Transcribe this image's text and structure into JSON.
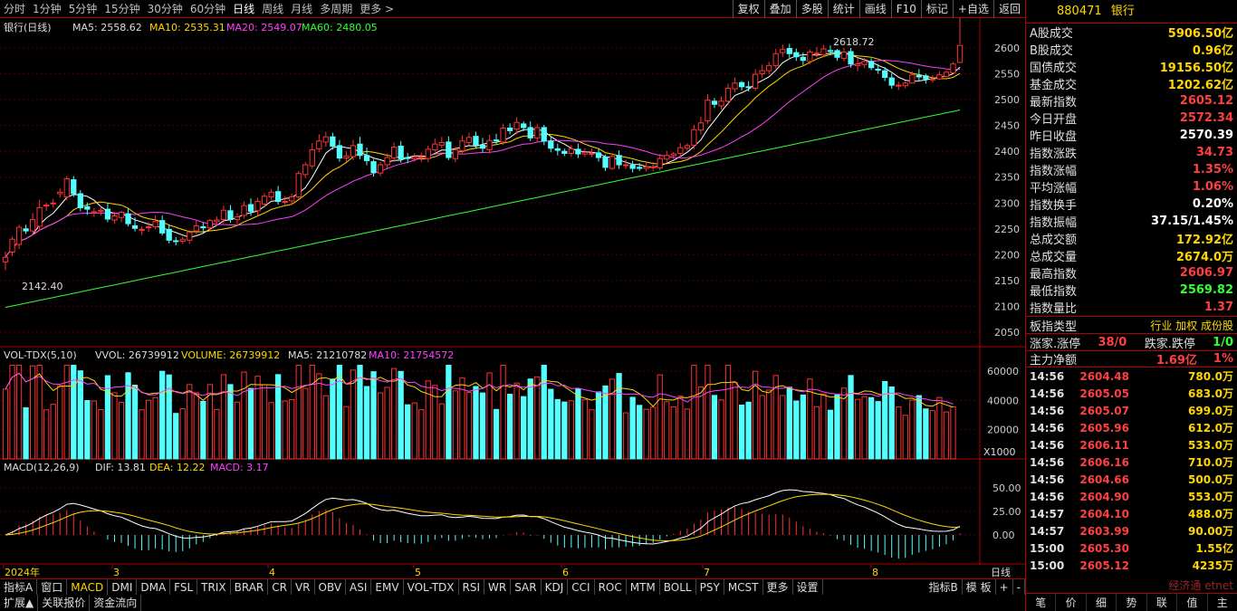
{
  "toolbar": {
    "periods": [
      "分时",
      "1分钟",
      "5分钟",
      "15分钟",
      "30分钟",
      "60分钟",
      "日线",
      "周线",
      "月线",
      "多周期",
      "更多 >"
    ],
    "active_period": "日线",
    "tools": [
      "复权",
      "叠加",
      "多股",
      "统计",
      "画线",
      "F10",
      "标记",
      "+自选",
      "返回"
    ]
  },
  "main_chart": {
    "name": "银行(日线)",
    "ma5": "MA5: 2558.62",
    "ma10": "MA10: 2535.31",
    "ma20": "MA20: 2549.07",
    "ma60": "MA60: 2480.05",
    "high_label": "2618.72",
    "low_label": "2142.40",
    "y_ticks": [
      "2600",
      "2550",
      "2500",
      "2450",
      "2400",
      "2350",
      "2300",
      "2250",
      "2200",
      "2150",
      "2100",
      "2050"
    ]
  },
  "vol_chart": {
    "header_name": "VOL-TDX(5,10)",
    "vvol": "VVOL: 26739912",
    "volume": "VOLUME: 26739912",
    "ma5": "MA5: 21210782",
    "ma10": "MA10: 21754572",
    "y_ticks": [
      "60000",
      "40000",
      "20000"
    ],
    "unit": "X1000"
  },
  "macd_chart": {
    "header_name": "MACD(12,26,9)",
    "dif": "DIF: 13.81",
    "dea": "DEA: 12.22",
    "macd": "MACD: 3.17",
    "y_ticks": [
      "50.00",
      "25.00",
      "0.00"
    ]
  },
  "x_axis": {
    "labels": [
      "2024年",
      "3",
      "4",
      "5",
      "6",
      "7",
      "8"
    ],
    "right_label": "日线"
  },
  "indicator_tabs": [
    "指标A",
    "窗口",
    "MACD",
    "DMI",
    "DMA",
    "FSL",
    "TRIX",
    "BRAR",
    "CR",
    "VR",
    "OBV",
    "ASI",
    "EMV",
    "VOL-TDX",
    "RSI",
    "WR",
    "SAR",
    "KDJ",
    "CCI",
    "ROC",
    "MTM",
    "BOLL",
    "PSY",
    "MCST",
    "更多",
    "设置"
  ],
  "indicator_right": [
    "指标B",
    "模 板",
    "+",
    "-"
  ],
  "bottom_tabs": [
    "扩展▲",
    "关联报价",
    "资金流向"
  ],
  "right_panel": {
    "code": "880471",
    "name": "银行",
    "stats": [
      {
        "label": "A股成交",
        "value": "5906.50亿",
        "color": "yellow"
      },
      {
        "label": "B股成交",
        "value": "0.96亿",
        "color": "yellow"
      },
      {
        "label": "国债成交",
        "value": "19156.50亿",
        "color": "yellow"
      },
      {
        "label": "基金成交",
        "value": "1202.62亿",
        "color": "yellow"
      },
      {
        "label": "最新指数",
        "value": "2605.12",
        "color": "red"
      },
      {
        "label": "今日开盘",
        "value": "2572.34",
        "color": "red"
      },
      {
        "label": "昨日收盘",
        "value": "2570.39",
        "color": "white"
      },
      {
        "label": "指数涨跌",
        "value": "34.73",
        "color": "red"
      },
      {
        "label": "指数涨幅",
        "value": "1.35%",
        "color": "red"
      },
      {
        "label": "平均涨幅",
        "value": "1.06%",
        "color": "red"
      },
      {
        "label": "指数换手",
        "value": "0.20%",
        "color": "white"
      },
      {
        "label": "指数振幅",
        "value": "37.15/1.45%",
        "color": "white"
      },
      {
        "label": "总成交额",
        "value": "172.92亿",
        "color": "yellow"
      },
      {
        "label": "总成交量",
        "value": "2674.0万",
        "color": "yellow"
      },
      {
        "label": "最高指数",
        "value": "2606.97",
        "color": "red"
      },
      {
        "label": "最低指数",
        "value": "2569.82",
        "color": "green"
      },
      {
        "label": "指数量比",
        "value": "1.37",
        "color": "red"
      }
    ],
    "type_label": "板指类型",
    "type_value": "行业 加权 成份股",
    "updown_label": "涨家.涨停",
    "updown_value": "38/0",
    "down_label": "跌家.跌停",
    "down_value": "1/0",
    "flow_label": "主力净额",
    "flow_value": "1.69亿",
    "flow_pct": "1%",
    "ticks": [
      {
        "t": "14:56",
        "p": "2604.48",
        "v": "780.0万"
      },
      {
        "t": "14:56",
        "p": "2605.05",
        "v": "683.0万"
      },
      {
        "t": "14:56",
        "p": "2605.07",
        "v": "699.0万"
      },
      {
        "t": "14:56",
        "p": "2605.96",
        "v": "612.0万"
      },
      {
        "t": "14:56",
        "p": "2606.11",
        "v": "533.0万"
      },
      {
        "t": "14:56",
        "p": "2606.16",
        "v": "710.0万"
      },
      {
        "t": "14:56",
        "p": "2604.66",
        "v": "500.0万"
      },
      {
        "t": "14:56",
        "p": "2604.90",
        "v": "553.0万"
      },
      {
        "t": "14:57",
        "p": "2604.10",
        "v": "488.0万"
      },
      {
        "t": "14:57",
        "p": "2603.99",
        "v": "90.00万"
      },
      {
        "t": "15:00",
        "p": "2605.30",
        "v": "1.55亿"
      },
      {
        "t": "15:00",
        "p": "2605.12",
        "v": "4235万"
      }
    ],
    "tabs": [
      "笔",
      "价",
      "细",
      "势",
      "联",
      "值",
      "主"
    ],
    "watermark": "经济通 etnet"
  },
  "chart_data": {
    "type": "candlestick",
    "close": [
      2195,
      2230,
      2253,
      2246,
      2268,
      2291,
      2296,
      2300,
      2321,
      2347,
      2318,
      2291,
      2288,
      2283,
      2286,
      2269,
      2275,
      2282,
      2260,
      2251,
      2249,
      2254,
      2264,
      2242,
      2228,
      2226,
      2230,
      2243,
      2256,
      2252,
      2266,
      2267,
      2286,
      2268,
      2273,
      2295,
      2284,
      2303,
      2313,
      2321,
      2303,
      2303,
      2312,
      2357,
      2374,
      2403,
      2420,
      2428,
      2410,
      2387,
      2391,
      2411,
      2392,
      2382,
      2359,
      2374,
      2388,
      2408,
      2385,
      2386,
      2388,
      2389,
      2404,
      2414,
      2417,
      2388,
      2403,
      2420,
      2427,
      2412,
      2406,
      2421,
      2421,
      2445,
      2440,
      2456,
      2446,
      2426,
      2446,
      2420,
      2406,
      2402,
      2396,
      2405,
      2395,
      2398,
      2396,
      2388,
      2369,
      2390,
      2374,
      2374,
      2367,
      2367,
      2370,
      2370,
      2386,
      2392,
      2395,
      2407,
      2411,
      2442,
      2455,
      2499,
      2491,
      2497,
      2522,
      2532,
      2525,
      2524,
      2549,
      2556,
      2566,
      2589,
      2597,
      2589,
      2583,
      2576,
      2592,
      2590,
      2598,
      2594,
      2582,
      2592,
      2569,
      2569,
      2574,
      2562,
      2557,
      2543,
      2528,
      2528,
      2532,
      2548,
      2544,
      2540,
      2540,
      2548,
      2553,
      2569,
      2605
    ],
    "open": [
      2186,
      2205,
      2220,
      2250,
      2246,
      2255,
      2295,
      2300,
      2318,
      2312,
      2345,
      2318,
      2293,
      2282,
      2284,
      2288,
      2267,
      2272,
      2279,
      2256,
      2248,
      2253,
      2254,
      2266,
      2249,
      2227,
      2226,
      2228,
      2246,
      2254,
      2252,
      2264,
      2268,
      2285,
      2268,
      2276,
      2297,
      2285,
      2298,
      2312,
      2322,
      2302,
      2304,
      2312,
      2355,
      2372,
      2405,
      2418,
      2428,
      2411,
      2387,
      2390,
      2414,
      2392,
      2380,
      2358,
      2374,
      2387,
      2410,
      2388,
      2385,
      2388,
      2386,
      2403,
      2412,
      2418,
      2386,
      2401,
      2417,
      2429,
      2412,
      2403,
      2422,
      2418,
      2445,
      2443,
      2453,
      2446,
      2426,
      2446,
      2420,
      2405,
      2400,
      2396,
      2404,
      2395,
      2396,
      2397,
      2389,
      2367,
      2392,
      2374,
      2373,
      2369,
      2367,
      2370,
      2368,
      2385,
      2392,
      2396,
      2406,
      2412,
      2441,
      2459,
      2497,
      2488,
      2497,
      2521,
      2533,
      2525,
      2522,
      2550,
      2556,
      2566,
      2591,
      2599,
      2591,
      2582,
      2574,
      2589,
      2587,
      2595,
      2595,
      2580,
      2593,
      2566,
      2568,
      2574,
      2559,
      2556,
      2542,
      2527,
      2527,
      2532,
      2547,
      2546,
      2540,
      2540,
      2545,
      2552,
      2572
    ],
    "high": [
      2206,
      2235,
      2258,
      2258,
      2281,
      2306,
      2301,
      2308,
      2328,
      2352,
      2352,
      2325,
      2301,
      2290,
      2295,
      2300,
      2283,
      2285,
      2290,
      2272,
      2255,
      2263,
      2276,
      2276,
      2258,
      2234,
      2235,
      2247,
      2266,
      2263,
      2269,
      2274,
      2295,
      2296,
      2280,
      2303,
      2309,
      2310,
      2319,
      2327,
      2333,
      2313,
      2318,
      2362,
      2379,
      2416,
      2433,
      2438,
      2436,
      2422,
      2400,
      2422,
      2428,
      2407,
      2385,
      2380,
      2396,
      2417,
      2420,
      2397,
      2396,
      2398,
      2411,
      2425,
      2428,
      2429,
      2409,
      2431,
      2436,
      2438,
      2426,
      2432,
      2434,
      2453,
      2454,
      2466,
      2458,
      2458,
      2453,
      2451,
      2429,
      2415,
      2405,
      2412,
      2415,
      2406,
      2406,
      2405,
      2394,
      2396,
      2402,
      2384,
      2382,
      2377,
      2379,
      2379,
      2395,
      2401,
      2399,
      2416,
      2416,
      2451,
      2467,
      2511,
      2503,
      2506,
      2531,
      2543,
      2536,
      2536,
      2559,
      2568,
      2573,
      2598,
      2607,
      2608,
      2599,
      2591,
      2597,
      2602,
      2606,
      2605,
      2598,
      2600,
      2600,
      2581,
      2581,
      2580,
      2569,
      2563,
      2551,
      2535,
      2536,
      2555,
      2559,
      2550,
      2548,
      2555,
      2557,
      2573,
      2607
    ],
    "low": [
      2170,
      2197,
      2211,
      2240,
      2238,
      2246,
      2285,
      2291,
      2310,
      2305,
      2312,
      2284,
      2277,
      2273,
      2276,
      2263,
      2260,
      2263,
      2255,
      2245,
      2238,
      2244,
      2249,
      2237,
      2222,
      2218,
      2221,
      2221,
      2239,
      2243,
      2245,
      2256,
      2261,
      2262,
      2259,
      2270,
      2275,
      2275,
      2291,
      2306,
      2297,
      2295,
      2296,
      2308,
      2348,
      2366,
      2398,
      2409,
      2403,
      2380,
      2380,
      2383,
      2385,
      2373,
      2351,
      2352,
      2367,
      2379,
      2378,
      2377,
      2380,
      2379,
      2379,
      2399,
      2406,
      2383,
      2379,
      2395,
      2412,
      2405,
      2398,
      2396,
      2414,
      2412,
      2433,
      2433,
      2439,
      2420,
      2418,
      2412,
      2398,
      2392,
      2391,
      2390,
      2387,
      2389,
      2389,
      2380,
      2362,
      2364,
      2366,
      2366,
      2359,
      2362,
      2361,
      2362,
      2363,
      2379,
      2385,
      2389,
      2401,
      2404,
      2433,
      2453,
      2484,
      2481,
      2489,
      2514,
      2518,
      2516,
      2517,
      2542,
      2549,
      2560,
      2583,
      2581,
      2575,
      2567,
      2569,
      2582,
      2583,
      2586,
      2575,
      2574,
      2562,
      2555,
      2561,
      2557,
      2550,
      2536,
      2521,
      2519,
      2522,
      2540,
      2536,
      2531,
      2533,
      2538,
      2543,
      2567
    ]
  }
}
